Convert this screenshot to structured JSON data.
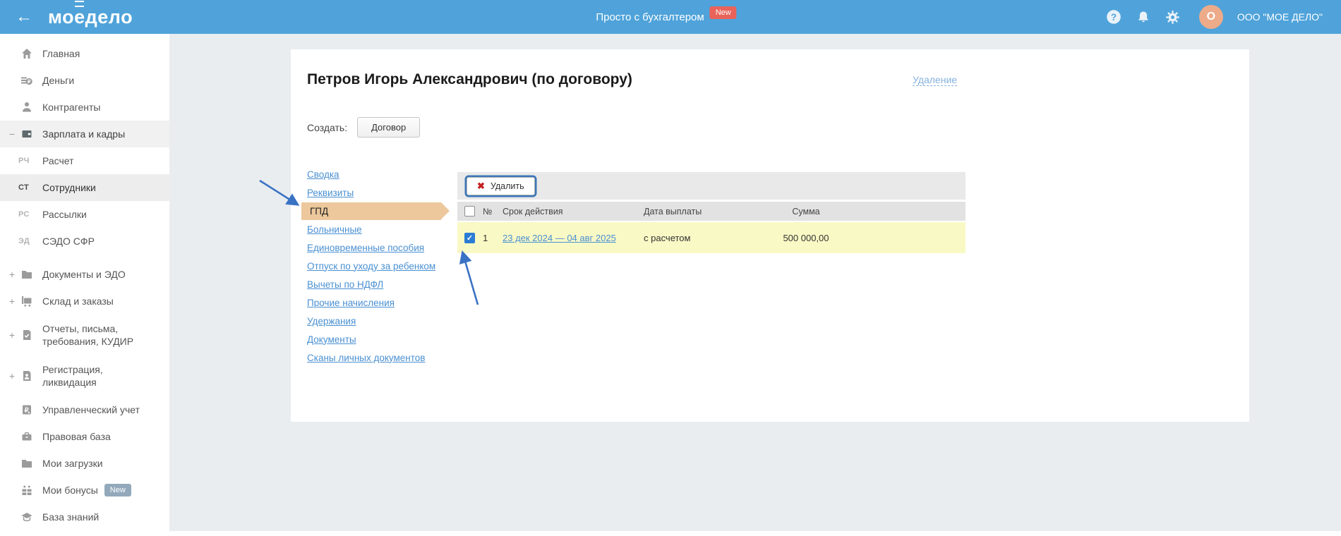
{
  "header": {
    "logo_prefix": "мо",
    "logo_e": "е",
    "logo_suffix": " дело",
    "back_arrow": "←",
    "tagline": "Просто с бухгалтером",
    "tagline_badge": "New",
    "account_initial": "O",
    "account_name": "ООО \"МОЕ ДЕЛО\""
  },
  "sidebar": {
    "items": [
      {
        "label": "Главная",
        "icon": "home-icon"
      },
      {
        "label": "Деньги",
        "icon": "money-icon"
      },
      {
        "label": "Контрагенты",
        "icon": "person-icon"
      },
      {
        "label": "Зарплата и кадры",
        "icon": "wallet-icon",
        "expander": "−"
      },
      {
        "label": "Расчет",
        "abbr": "РЧ"
      },
      {
        "label": "Сотрудники",
        "abbr": "СТ"
      },
      {
        "label": "Рассылки",
        "abbr": "РС"
      },
      {
        "label": "СЭДО СФР",
        "abbr": "ЭД"
      },
      {
        "label": "Документы и ЭДО",
        "icon": "folder-icon",
        "expander": "+"
      },
      {
        "label": "Склад и заказы",
        "icon": "cart-icon",
        "expander": "+"
      },
      {
        "label": "Отчеты, письма,\nтребования, КУДИР",
        "icon": "report-icon",
        "expander": "+"
      },
      {
        "label": "Регистрация,\nликвидация",
        "icon": "registration-icon",
        "expander": "+"
      },
      {
        "label": "Управленческий учет",
        "icon": "ruble-icon"
      },
      {
        "label": "Правовая база",
        "icon": "briefcase-icon"
      },
      {
        "label": "Мои загрузки",
        "icon": "downloads-icon"
      },
      {
        "label": "Мои бонусы",
        "icon": "gift-icon",
        "badge": "New"
      },
      {
        "label": "База знаний",
        "icon": "knowledge-icon"
      }
    ]
  },
  "main": {
    "title": "Петров Игорь Александрович (по договору)",
    "delete_link": "Удаление",
    "create_label": "Создать:",
    "create_button": "Договор",
    "nav_links": [
      "Сводка",
      "Реквизиты",
      "ГПД",
      "Больничные",
      "Единовременные пособия",
      "Отпуск по уходу за ребенком",
      "Вычеты по НДФЛ",
      "Прочие начисления",
      "Удержания",
      "Документы",
      "Сканы личных документов"
    ],
    "selected_nav": "ГПД",
    "table": {
      "delete_button": "Удалить",
      "delete_icon": "✖",
      "columns": [
        "№",
        "Срок действия",
        "Дата выплаты",
        "Сумма"
      ],
      "rows": [
        {
          "num": "1",
          "period": "23 дек 2024 — 04 авг 2025",
          "payment": "с расчетом",
          "amount": "500 000,00",
          "checked": true
        }
      ]
    }
  },
  "colors": {
    "header_blue": "#4fa3da",
    "badge_red": "#e9635a",
    "avatar_orange": "#edab89",
    "link_blue": "#4a90d2",
    "selected_tab_bg": "#ecc89c",
    "row_yellow": "#f9f9c5",
    "arrow_blue": "#3a72c4",
    "sidebar_badge_gray": "#93a9bb"
  }
}
